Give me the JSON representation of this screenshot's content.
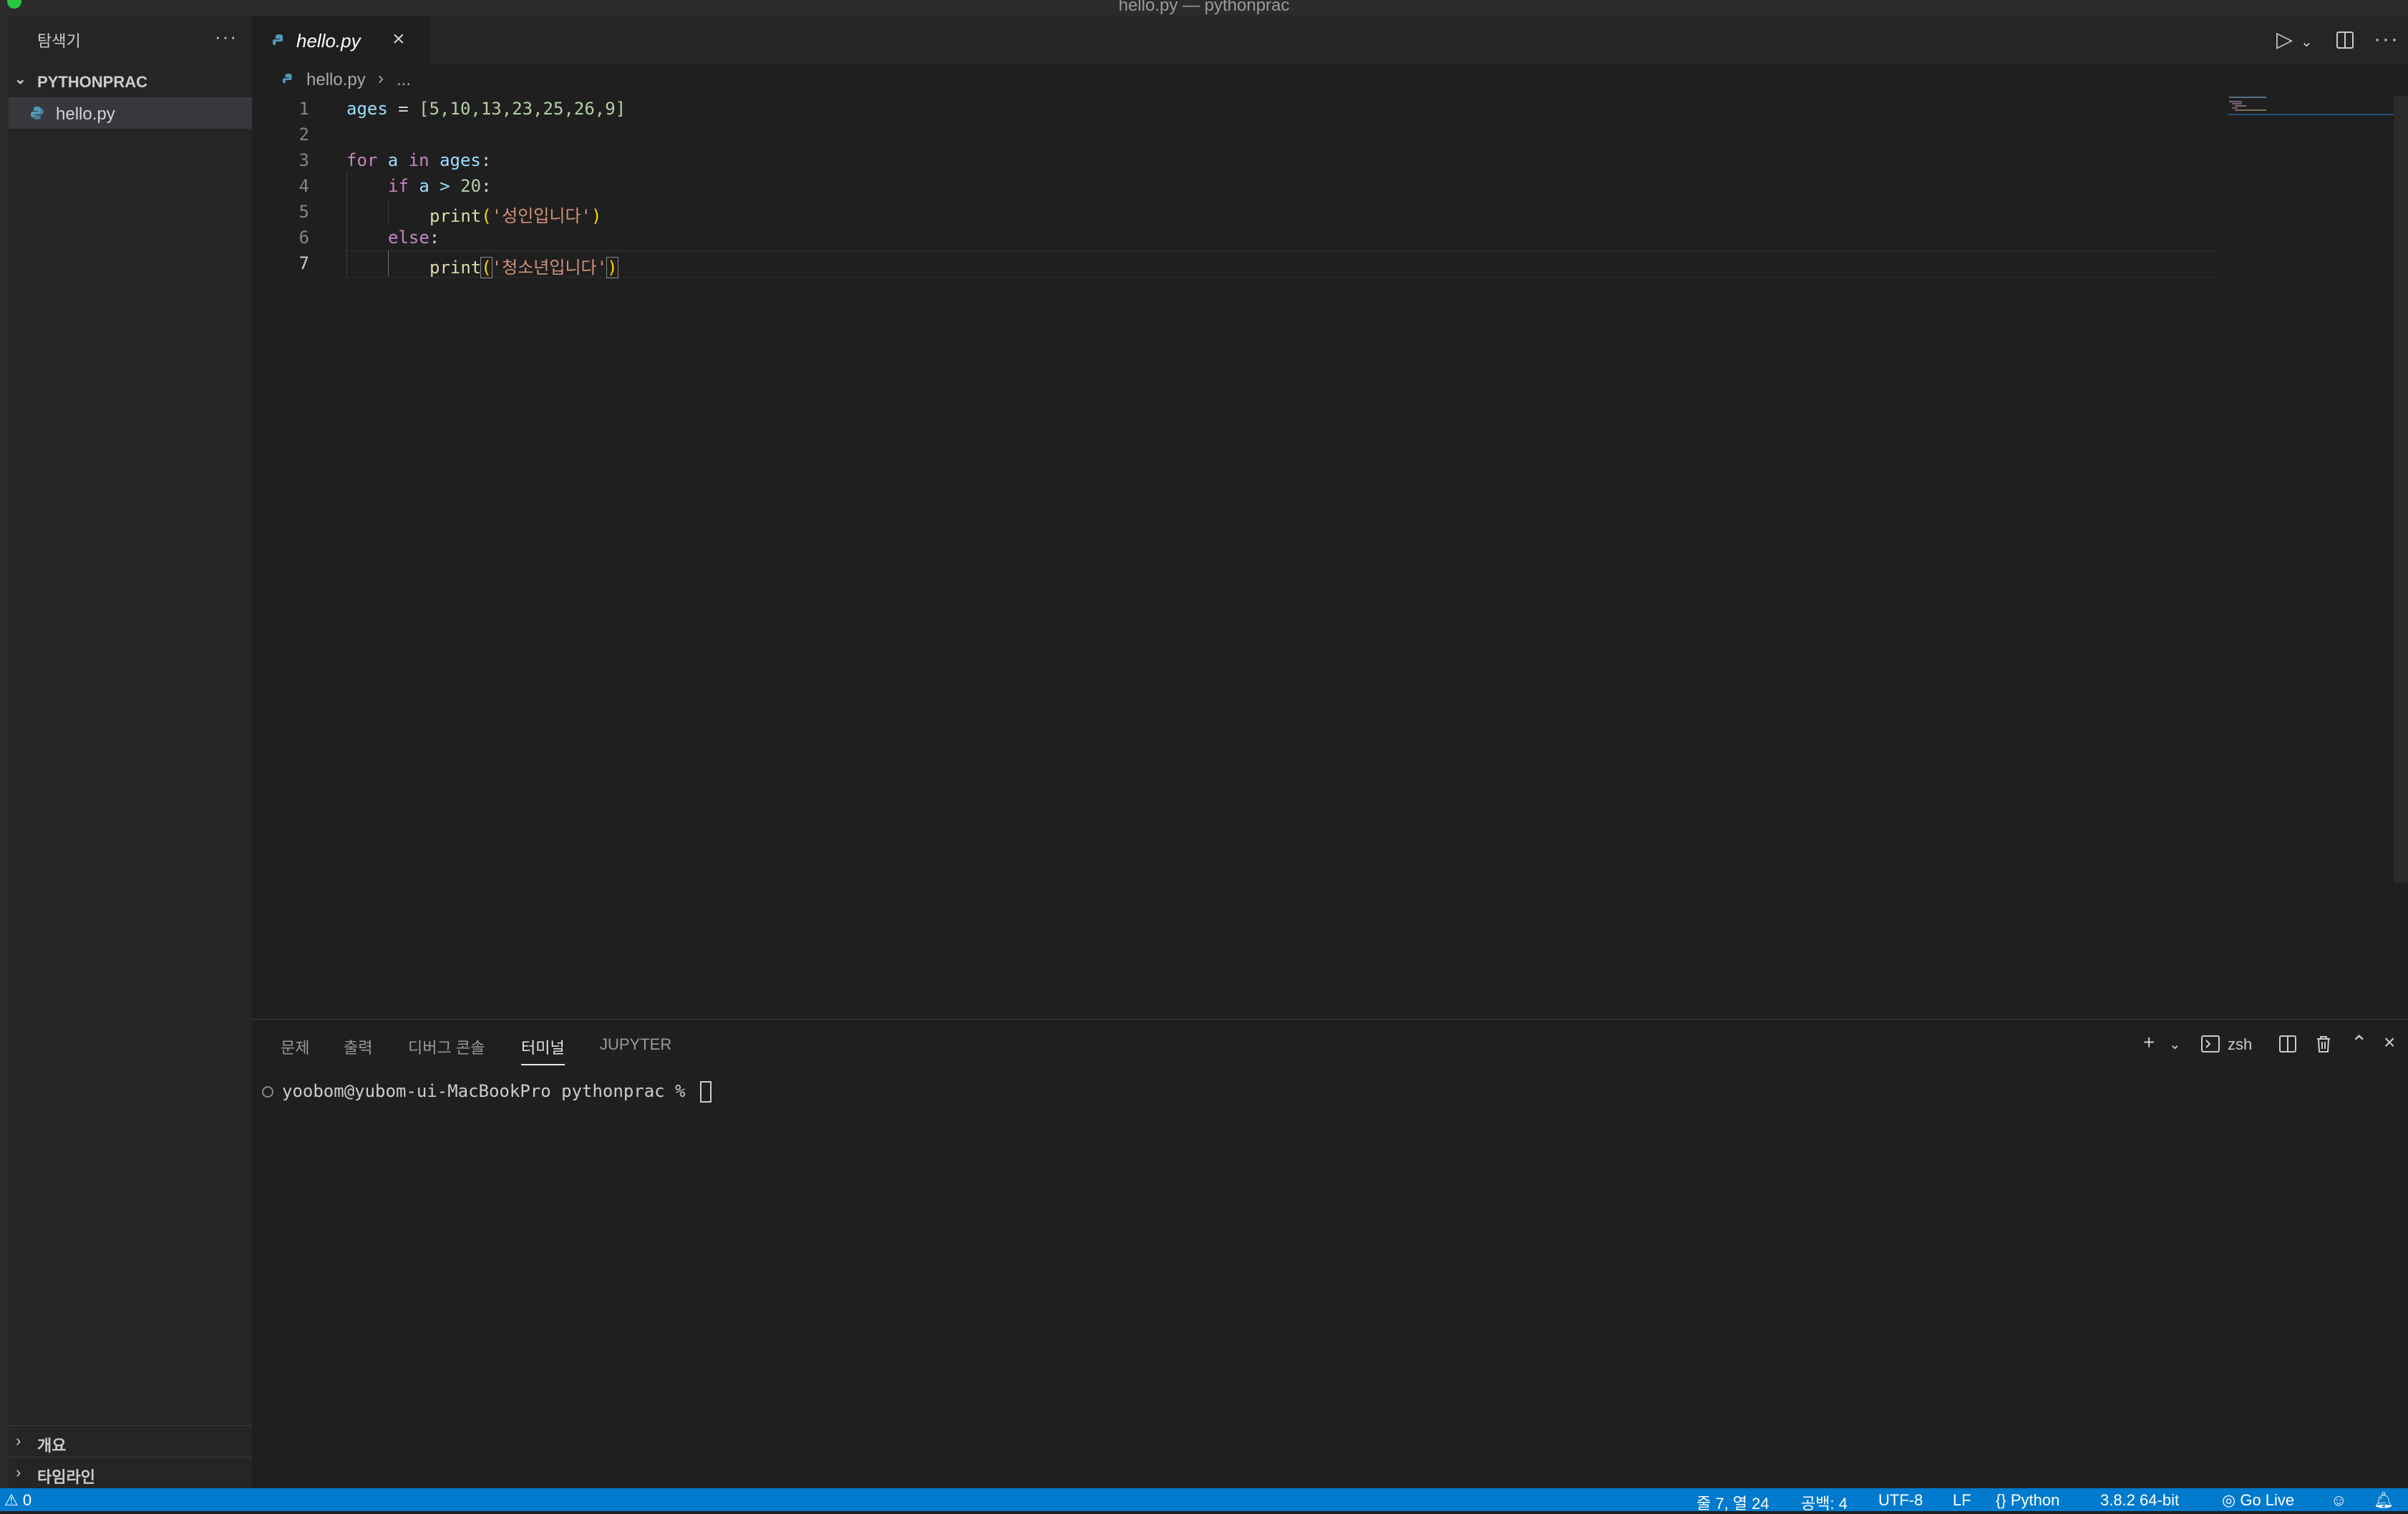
{
  "window": {
    "title": "hello.py — pythonprac"
  },
  "sidebar": {
    "header": "탐색기",
    "more": "···",
    "folder": "PYTHONPRAC",
    "file": "hello.py",
    "outline": "개요",
    "timeline": "타임라인"
  },
  "editor": {
    "tab_label": "hello.py",
    "breadcrumb_file": "hello.py",
    "breadcrumb_rest": "...",
    "line_numbers": [
      "1",
      "2",
      "3",
      "4",
      "5",
      "6",
      "7"
    ],
    "active_line": 7
  },
  "code": {
    "l1_var": "ages",
    "l1_eq": " = ",
    "l1_list": "[5,10,13,23,25,26,9]",
    "l3_for": "for",
    "l3_a": " a ",
    "l3_in": "in",
    "l3_ages": " ages",
    "l3_colon": ":",
    "l4_if": "if",
    "l4_cond": " a > ",
    "l4_num": "20",
    "l4_colon": ":",
    "l5_fn": "print",
    "l5_str": "'성인입니다'",
    "l6_else": "else",
    "l6_colon": ":",
    "l7_fn": "print",
    "l7_str": "'청소년입니다'"
  },
  "panel": {
    "tabs": [
      "문제",
      "출력",
      "디버그 콘솔",
      "터미널",
      "JUPYTER"
    ],
    "active_tab": "터미널",
    "shell": "zsh",
    "prompt": "yoobom@yubom-ui-MacBookPro pythonprac % "
  },
  "statusbar": {
    "problems": "0",
    "cursor_pos": "줄 7, 열 24",
    "spaces": "공백: 4",
    "encoding": "UTF-8",
    "eol": "LF",
    "language": "Python",
    "interpreter": "3.8.2 64-bit",
    "golive": "Go Live"
  },
  "colors": {
    "accent": "#007acc",
    "editor_bg": "#1f1f1f",
    "sidebar_bg": "#252526"
  }
}
